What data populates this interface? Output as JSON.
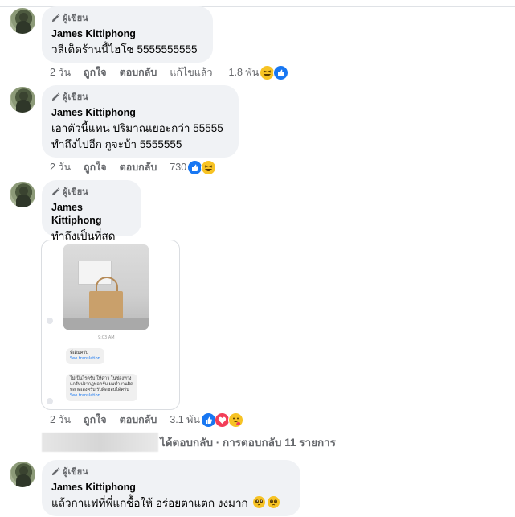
{
  "badge_label": "ผู้เขียน",
  "comments": [
    {
      "author": "James Kittiphong",
      "lines": [
        "วลีเด็ดร้านนี้ไฮโซ 5555555555"
      ],
      "time": "2 วัน",
      "like": "ถูกใจ",
      "reply": "ตอบกลับ",
      "edited": "แก้ไขแล้ว",
      "reaction_count": "1.8 พัน",
      "reactions": [
        "haha-icon",
        "like-icon"
      ]
    },
    {
      "author": "James Kittiphong",
      "lines": [
        "เอาตัวนี้แทน ปริมาณเยอะกว่า 55555",
        "ทำถึงไปอีก กูจะบ้า 5555555"
      ],
      "time": "2 วัน",
      "like": "ถูกใจ",
      "reply": "ตอบกลับ",
      "reaction_count": "730",
      "reactions": [
        "like-icon",
        "haha-icon"
      ]
    },
    {
      "author": "James Kittiphong",
      "lines": [
        "ทำถึงเป็นที่สุด"
      ],
      "time": "2 วัน",
      "like": "ถูกใจ",
      "reply": "ตอบกลับ",
      "reaction_count": "3.1 พัน",
      "reactions": [
        "like-icon",
        "love-icon",
        "care-icon"
      ]
    },
    {
      "author": "James Kittiphong",
      "lines": [
        "แล้วกาแฟที่พี่แกซื้อให้ อร่อยตาแตก งงมาก"
      ],
      "emojis": [
        "pleading-face-icon",
        "pleading-face-icon"
      ]
    }
  ],
  "attachment": {
    "timestamp": "9:03 AM",
    "msg1": "ที่เดิมครับ",
    "msg2_line1": "ไม่เป็นไรครับ ให้ดาว ในช่องทาง",
    "msg2_line2": "แกรับปรากฏพอครับ ผมทำงานผิด",
    "msg2_line3": "พลาดเองครับ รับผิดชอบได้ครับ",
    "see_translation": "See translation"
  },
  "replies_summary": "ได้ตอบกลับ · การตอบกลับ 11 รายการ"
}
